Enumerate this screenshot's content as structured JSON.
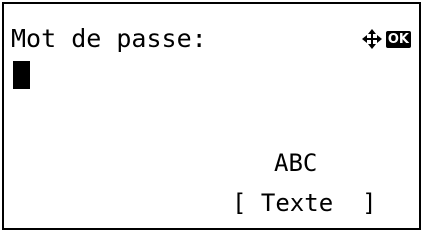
{
  "screen": {
    "title": "Mot de passe:",
    "nav_icon": "four-way-arrow-icon",
    "ok_label": "OK",
    "input_mode": "ABC",
    "softkey": {
      "open": "[",
      "label": "Texte",
      "close": "]"
    }
  }
}
